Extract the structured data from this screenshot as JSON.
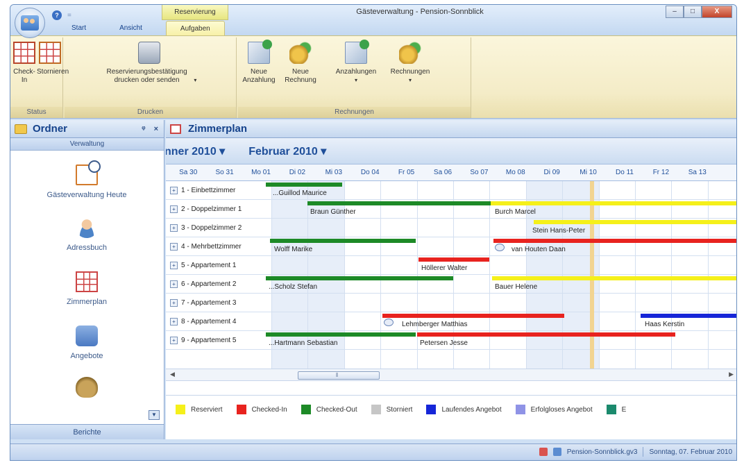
{
  "window": {
    "title": "Gästeverwaltung - Pension-Sonnblick",
    "context_tab": "Reservierung",
    "buttons": {
      "minimize": "–",
      "maximize": "□",
      "close": "X"
    }
  },
  "quick_access": {
    "help": "?",
    "separator": "="
  },
  "tabs": [
    "Start",
    "Ansicht",
    "Aufgaben"
  ],
  "active_tab": "Aufgaben",
  "ribbon": {
    "groups": [
      {
        "caption": "Status",
        "buttons": [
          {
            "label": "Check-In",
            "icon": "checkin-grid-icon"
          },
          {
            "label": "Stornieren",
            "icon": "cancel-grid-icon"
          }
        ]
      },
      {
        "caption": "Drucken",
        "buttons": [
          {
            "label": "Reservierungsbestätigung drucken oder senden",
            "icon": "printer-icon",
            "dropdown": "▾"
          }
        ]
      },
      {
        "caption": "Rechnungen",
        "buttons": [
          {
            "label": "Neue Anzahlung",
            "icon": "new-deposit-icon"
          },
          {
            "label": "Neue Rechnung",
            "icon": "new-invoice-icon"
          },
          {
            "label": "Anzahlungen",
            "icon": "deposits-icon",
            "dropdown": "▾"
          },
          {
            "label": "Rechnungen",
            "icon": "invoices-icon",
            "dropdown": "▾"
          }
        ]
      }
    ]
  },
  "left_pane": {
    "title": "Ordner",
    "pin": "ᵠ",
    "close": "×",
    "section": "Verwaltung",
    "items": [
      {
        "label": "Gästeverwaltung Heute",
        "icon": "calendar-clock-icon"
      },
      {
        "label": "Adressbuch",
        "icon": "person-icon"
      },
      {
        "label": "Zimmerplan",
        "icon": "room-plan-icon"
      },
      {
        "label": "Angebote",
        "icon": "offers-icon"
      },
      {
        "label": "",
        "icon": "money-bag-icon"
      }
    ],
    "footer": "Berichte",
    "scroll_down": "▼"
  },
  "main": {
    "title": "Zimmerplan",
    "months": [
      "nner 2010 ▾",
      "Februar 2010 ▾"
    ],
    "days": [
      "Sa 30",
      "So 31",
      "Mo 01",
      "Di 02",
      "Mi 03",
      "Do 04",
      "Fr 05",
      "Sa 06",
      "So 07",
      "Mo 08",
      "Di 09",
      "Mi 10",
      "Do 11",
      "Fr 12",
      "Sa 13"
    ],
    "rooms": [
      "1 - Einbettzimmer",
      "2 - Doppelzimmer 1",
      "3 - Doppelzimmer 2",
      "4 - Mehrbettzimmer",
      "5 - Appartement 1",
      "6 - Appartement 2",
      "7 - Appartement 3",
      "8 - Appartement 4",
      "9 - Appartement 5"
    ],
    "expand": "+",
    "guests": [
      {
        "room": 0,
        "name": "...Guillod Maurice"
      },
      {
        "room": 1,
        "name": "Braun Günther"
      },
      {
        "room": 1,
        "name": "Burch Marcel"
      },
      {
        "room": 2,
        "name": "Stein Hans-Peter"
      },
      {
        "room": 3,
        "name": "Wolff Marike"
      },
      {
        "room": 3,
        "name": "van Houten Daan"
      },
      {
        "room": 4,
        "name": "Höllerer Walter"
      },
      {
        "room": 5,
        "name": "...Scholz Stefan"
      },
      {
        "room": 5,
        "name": "Bauer Helene"
      },
      {
        "room": 7,
        "name": "Lehmberger Matthias"
      },
      {
        "room": 7,
        "name": "Haas Kerstin"
      },
      {
        "room": 8,
        "name": "...Hartmann Sebastian"
      },
      {
        "room": 8,
        "name": "Petersen Jesse"
      }
    ],
    "scroll": {
      "left": "◀",
      "right": "▶",
      "thumb": "⦀"
    },
    "legend": [
      {
        "label": "Reserviert",
        "color": "#f5f01a"
      },
      {
        "label": "Checked-In",
        "color": "#e8231f"
      },
      {
        "label": "Checked-Out",
        "color": "#1d8a27"
      },
      {
        "label": "Storniert",
        "color": "#c6c6c6"
      },
      {
        "label": "Laufendes Angebot",
        "color": "#1626d8"
      },
      {
        "label": "Erfolgloses Angebot",
        "color": "#8f93e6"
      },
      {
        "label": "E",
        "color": "#1b8a6d"
      }
    ]
  },
  "statusbar": {
    "file": "Pension-Sonnblick.gv3",
    "date": "Sonntag, 07. Februar 2010"
  }
}
